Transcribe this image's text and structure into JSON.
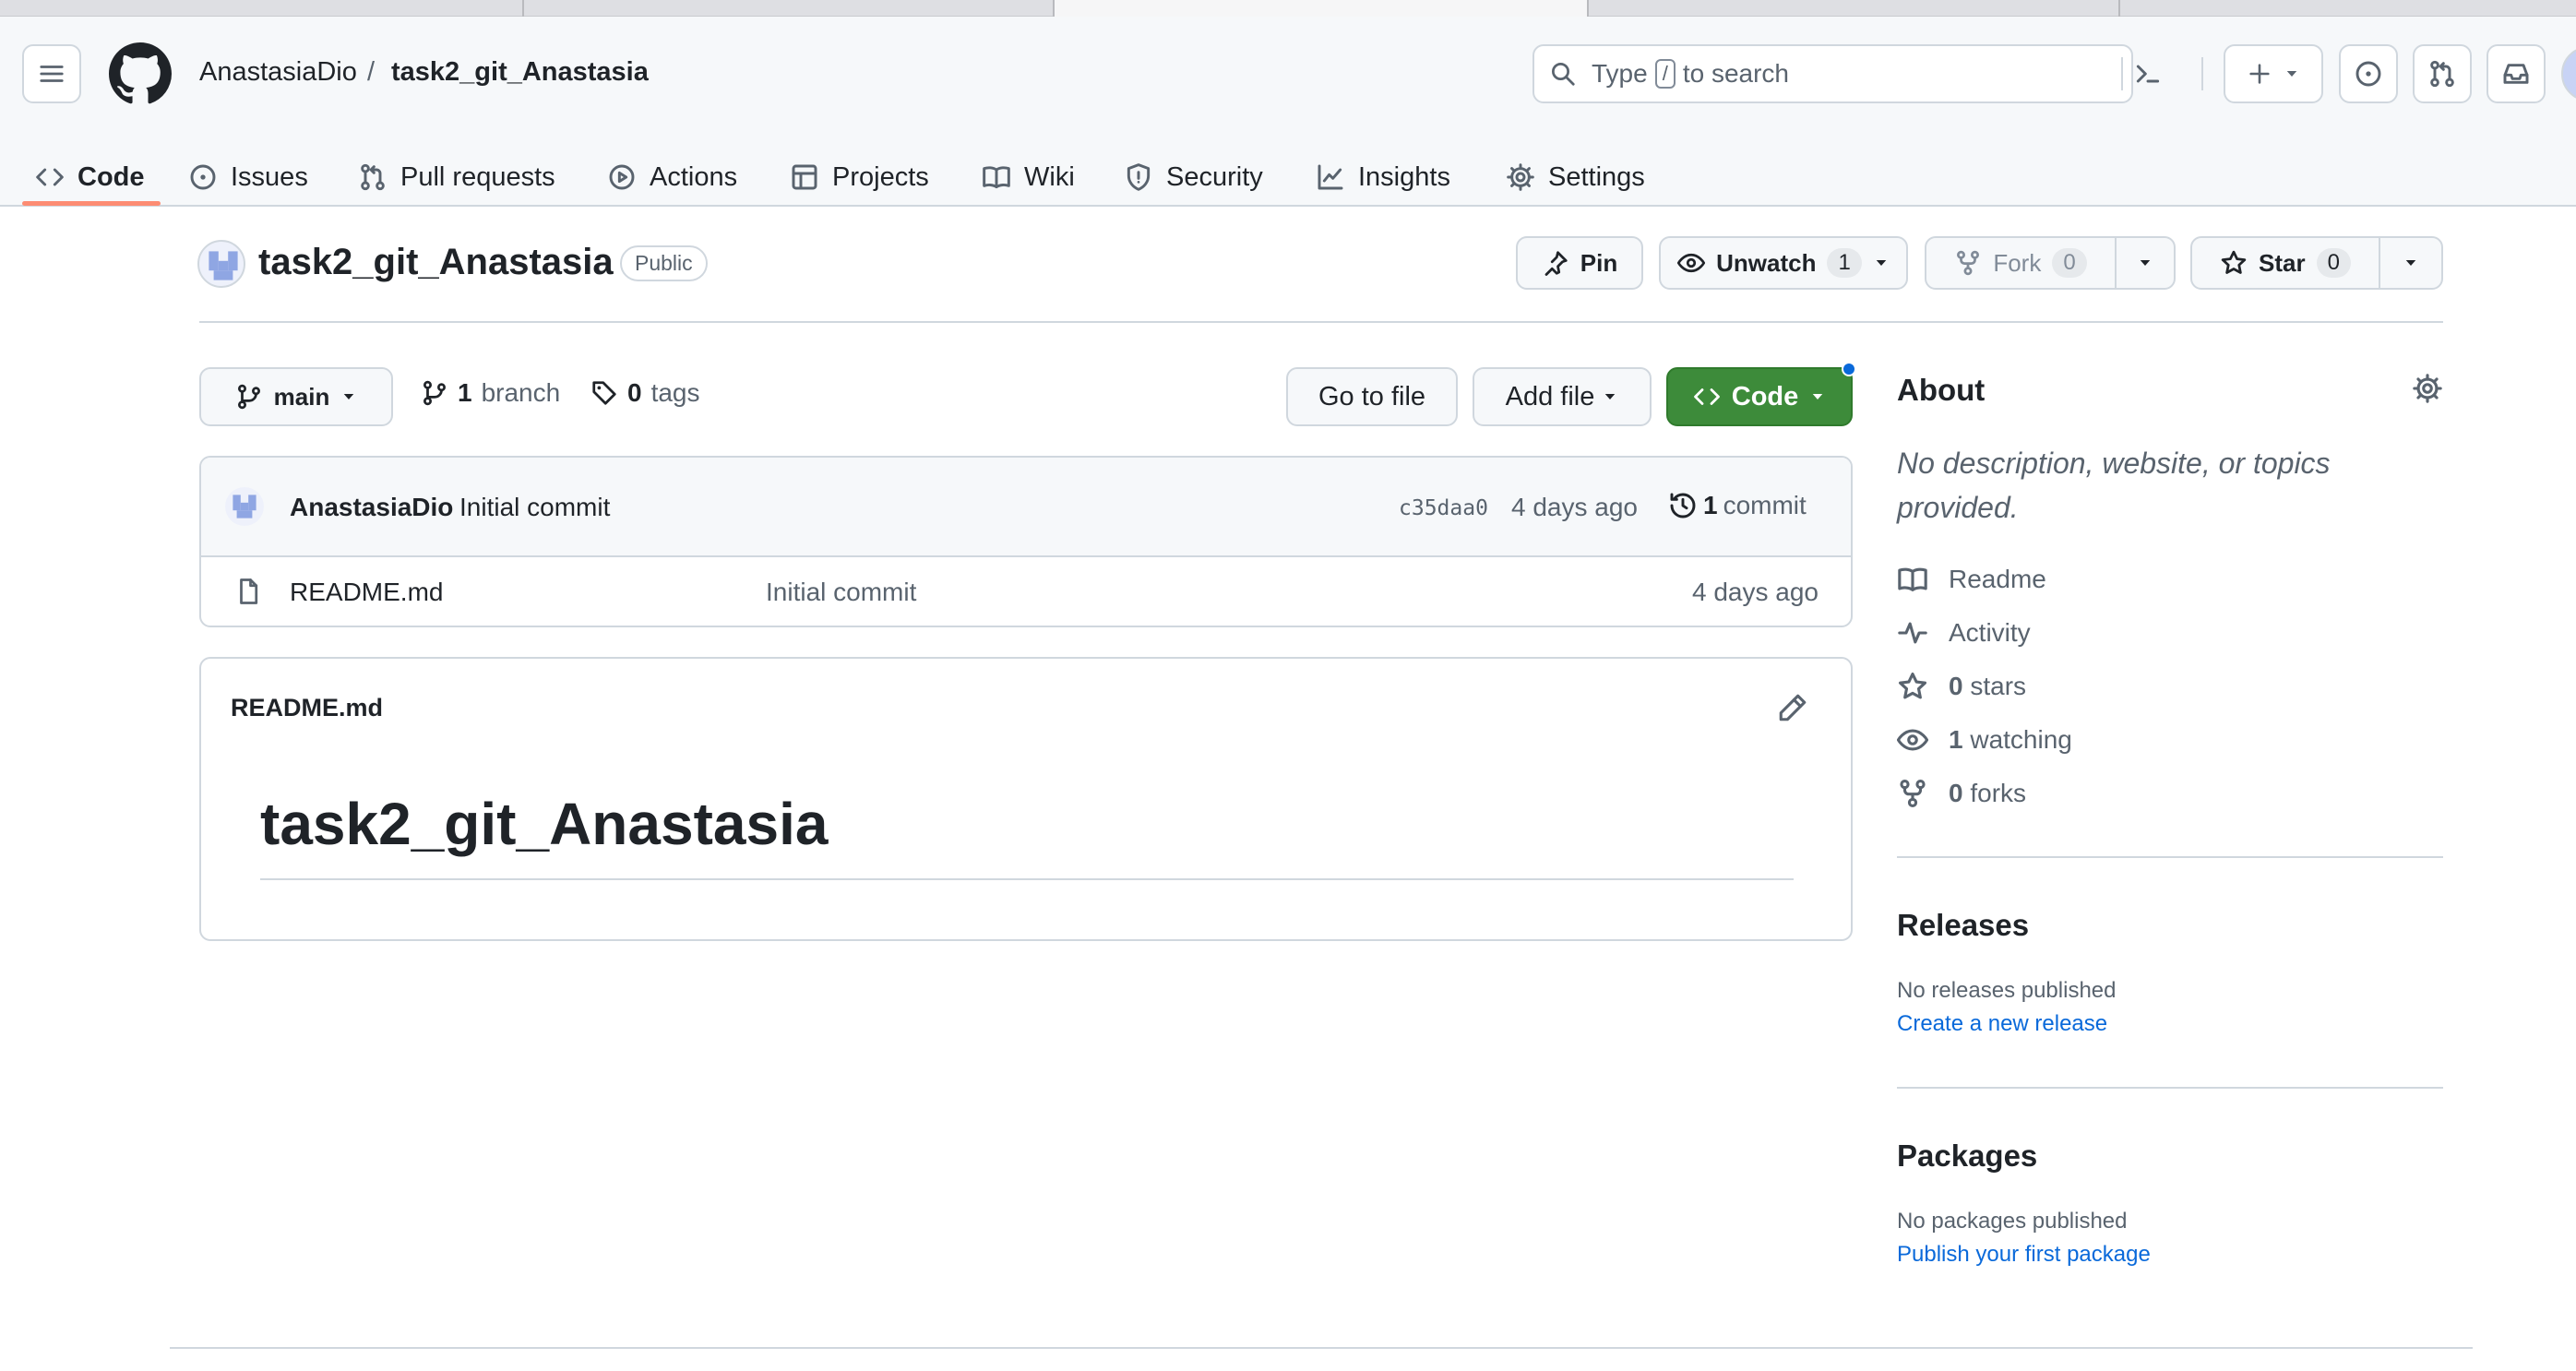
{
  "breadcrumb": {
    "owner": "AnastasiaDio",
    "separator": "/",
    "repo": "task2_git_Anastasia"
  },
  "search": {
    "prefix": "Type",
    "key": "/",
    "suffix": "to search"
  },
  "nav_tabs": [
    {
      "label": "Code"
    },
    {
      "label": "Issues"
    },
    {
      "label": "Pull requests"
    },
    {
      "label": "Actions"
    },
    {
      "label": "Projects"
    },
    {
      "label": "Wiki"
    },
    {
      "label": "Security"
    },
    {
      "label": "Insights"
    },
    {
      "label": "Settings"
    }
  ],
  "repo": {
    "name": "task2_git_Anastasia",
    "visibility": "Public"
  },
  "actions": {
    "pin": "Pin",
    "unwatch": "Unwatch",
    "watch_count": "1",
    "fork": "Fork",
    "fork_count": "0",
    "star": "Star",
    "star_count": "0"
  },
  "branch_bar": {
    "branch": "main",
    "branch_count": "1",
    "branch_label": "branch",
    "tag_count": "0",
    "tag_label": "tags",
    "go_to_file": "Go to file",
    "add_file": "Add file",
    "code": "Code"
  },
  "latest_commit": {
    "author": "AnastasiaDio",
    "message": "Initial commit",
    "sha": "c35daa0",
    "time": "4 days ago",
    "count": "1",
    "count_label": "commit"
  },
  "files": [
    {
      "name": "README.md",
      "message": "Initial commit",
      "time": "4 days ago"
    }
  ],
  "readme": {
    "filename": "README.md",
    "heading": "task2_git_Anastasia"
  },
  "about": {
    "title": "About",
    "description": "No description, website, or topics provided.",
    "links": [
      {
        "icon": "book-icon",
        "label": "Readme",
        "count": ""
      },
      {
        "icon": "pulse-icon",
        "label": "Activity",
        "count": ""
      },
      {
        "icon": "star-icon",
        "label": "stars",
        "count": "0"
      },
      {
        "icon": "eye-icon",
        "label": "watching",
        "count": "1"
      },
      {
        "icon": "fork-icon",
        "label": "forks",
        "count": "0"
      }
    ]
  },
  "releases": {
    "title": "Releases",
    "empty": "No releases published",
    "link": "Create a new release"
  },
  "packages": {
    "title": "Packages",
    "empty": "No packages published",
    "link": "Publish your first package"
  },
  "colors": {
    "accent_green": "#2da44e",
    "link_blue": "#0969da",
    "tab_underline": "#fd8c73",
    "border": "#d0d7de"
  }
}
